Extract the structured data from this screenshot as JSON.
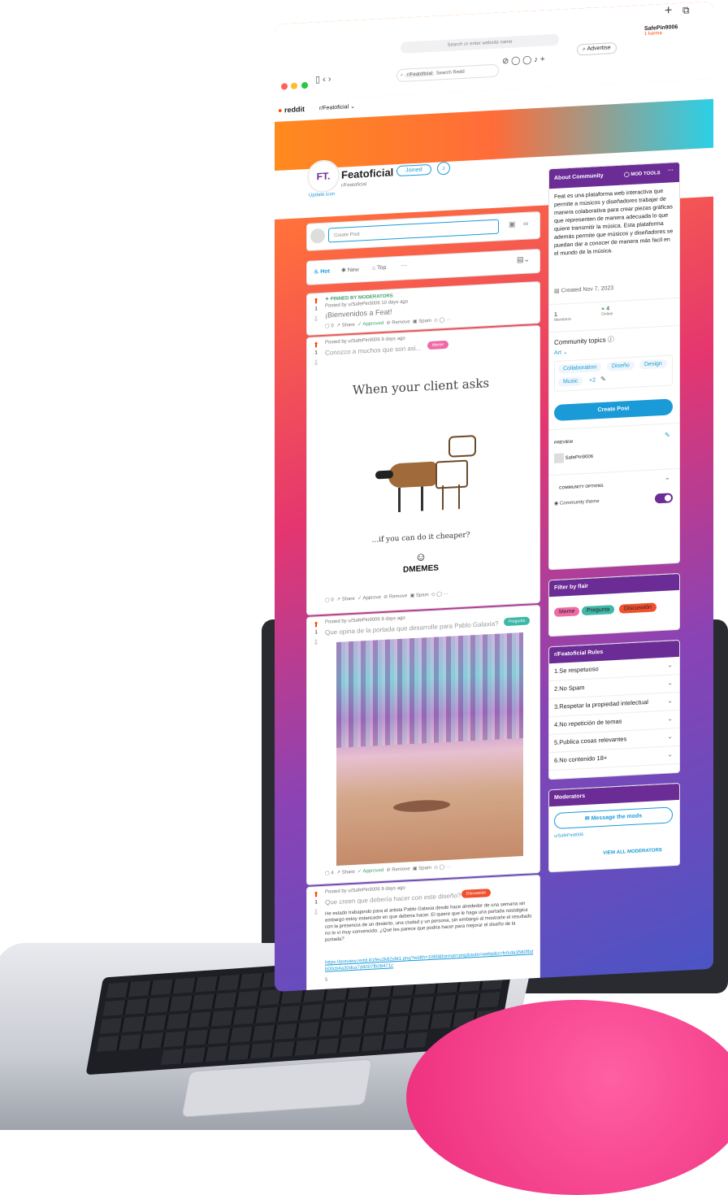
{
  "browser": {
    "search_placeholder": "Search or enter website name",
    "new_tab_icon": "+",
    "tabs_icon": "tabs-icon",
    "user": "SafePin9006",
    "karma": "1 karma",
    "advertise": "Advertise",
    "search_reddit": "Search Redd",
    "search_chip": "r/Featoficial"
  },
  "reddit": {
    "logo": "reddit",
    "community_chip": "r/Featoficial"
  },
  "community": {
    "name": "Featoficial",
    "subname": "r/Featoficial",
    "joined": "Joined",
    "update_icon": "Update icon",
    "logo_text": "FT."
  },
  "create_post": {
    "placeholder": "Create Post"
  },
  "sort": {
    "hot": "Hot",
    "new": "New",
    "top": "Top",
    "more": "···"
  },
  "posts": [
    {
      "pinned": "PINNED BY MODERATORS",
      "meta": "Posted by u/SafePin9006 10 days ago",
      "title": "¡Bienvenidos a Feat!",
      "votes": "1",
      "comments": "0",
      "share": "Share",
      "approved": "Approved",
      "remove": "Remove",
      "spam": "Spam"
    },
    {
      "meta": "Posted by u/SafePin9006 9 days ago",
      "title": "Conozco a muchos que son asi...",
      "flair": "Meme",
      "votes": "1",
      "meme_top": "When your client asks",
      "meme_bottom": "...if you can do it cheaper?",
      "meme_brand": "DMEMES",
      "comments": "0",
      "share": "Share",
      "approved": "Approve",
      "remove": "Remove",
      "spam": "Spam"
    },
    {
      "meta": "Posted by u/SafePin9006 9 days ago",
      "title": "Que opina de la portada que desarrolle para Pablo Galaxia?",
      "flair": "Pregunta",
      "votes": "1",
      "comments": "4",
      "share": "Share",
      "approved": "Approved",
      "remove": "Remove",
      "spam": "Spam"
    },
    {
      "meta": "Posted by u/SafePin9006 9 days ago",
      "title": "Que creen que debería hacer con este diseño?",
      "flair": "Discussión",
      "votes": "1",
      "body": "He estado trabajando para el artista Pablo Galaxia desde hace alrededor de una semana sin embargo estoy estancado en que deberia hacer. El quiere que le haga una portada nostalgica con la presencia de un desierto, una ciudad y un persona, sin embargo al mostrarle el resultado no lo vi muy convencido. ¿Que les parece que podria hacer para mejorar el diseño de la portada?",
      "link": "https://preview.redd.it/zfeu2k82ybt1.png?width=1080&format=png&auto=webp&s=fcfcda3580fbdb00cb4a30dca7d4007fb08471c",
      "tail": "5"
    }
  ],
  "about": {
    "title": "About Community",
    "mod_tools": "MOD TOOLS",
    "description": "Feat es una plataforma web interactiva que permite a músicos y diseñadores trabajar de manera colaborativa para crear piezas gráficas que representen de manera adecuada lo que quiere transmitir la música. Esta plataforma además permite que músicos y diseñadores se puedan dar a conocer de manera más facil en el mundo de la música.",
    "created": "Created Nov 7, 2023",
    "members_count": "1",
    "members_label": "Members",
    "online_count": "4",
    "online_label": "Online",
    "topics_title": "Community topics",
    "topic_main": "Art",
    "topics": [
      "Collaboration",
      "Diseño",
      "Design",
      "Music",
      "+2"
    ],
    "create_post": "Create Post",
    "preview_label": "PREVIEW",
    "preview_user": "SafePin9006",
    "options_label": "COMMUNITY OPTIONS",
    "theme_label": "Community theme"
  },
  "flair_filter": {
    "title": "Filter by flair",
    "items": [
      {
        "label": "Meme",
        "color": "#f06ba6"
      },
      {
        "label": "Pregunta",
        "color": "#3fb8a8"
      },
      {
        "label": "Discussión",
        "color": "#f0502e"
      }
    ]
  },
  "rules": {
    "title": "r/Featoficial Rules",
    "items": [
      "1.Se respetuoso",
      "2.No Spam",
      "3.Respetar la propiedad intelectual",
      "4.No repetición de temas",
      "5.Publica cosas relevantes",
      "6.No contenido 18+"
    ]
  },
  "moderators": {
    "title": "Moderators",
    "message": "Message the mods",
    "user": "u/SafePin9006",
    "view_all": "VIEW ALL MODERATORS"
  },
  "colors": {
    "purple": "#6a2a9e",
    "orange": "#ff4500",
    "blue": "#1a9bd7",
    "sidebar_header": "#6b2c95"
  }
}
